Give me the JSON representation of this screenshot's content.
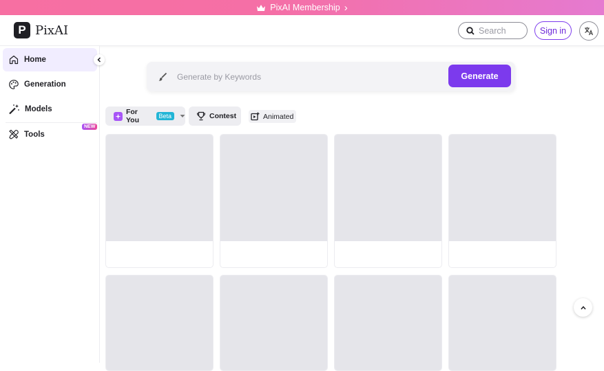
{
  "banner": {
    "text": "PixAI Membership",
    "arrow": "›"
  },
  "header": {
    "logo_mark": "P",
    "logo_text": "PixAI",
    "search_placeholder": "Search",
    "signin_label": "Sign in",
    "lang_icon": "translate-icon"
  },
  "sidebar": {
    "items": [
      {
        "label": "Home",
        "icon": "home-icon",
        "active": true
      },
      {
        "label": "Generation",
        "icon": "palette-icon"
      },
      {
        "label": "Models",
        "icon": "magic-wand-icon"
      },
      {
        "label": "Tools",
        "icon": "tools-icon",
        "badge": "NEW"
      }
    ],
    "collapse_icon": "chevron-left-icon"
  },
  "generate": {
    "placeholder": "Generate by Keywords",
    "button_label": "Generate"
  },
  "tabs": {
    "for_you": "For You",
    "beta": "Beta",
    "contest": "Contest",
    "animated": "Animated"
  },
  "colors": {
    "accent": "#7c3aed",
    "beta": "#22b5d6",
    "placeholder_card": "#e5e5ea"
  },
  "cards": [
    {
      "id": 1
    },
    {
      "id": 2
    },
    {
      "id": 3
    },
    {
      "id": 4
    },
    {
      "id": 5
    },
    {
      "id": 6
    },
    {
      "id": 7
    },
    {
      "id": 8
    }
  ]
}
